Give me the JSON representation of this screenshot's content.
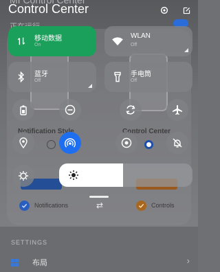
{
  "header": {
    "ghost_title": "MI Control Center",
    "title": "Control Center",
    "icons": [
      "settings-gear-icon",
      "edit-icon"
    ]
  },
  "background": {
    "subtitle": "正在运行",
    "notification_style_label": "Notification Style",
    "control_center_label": "Control Center",
    "tabs": {
      "notifications": "Notifications",
      "controls": "Controls"
    },
    "settings_heading": "SETTINGS",
    "layout_label": "布局"
  },
  "tiles": [
    {
      "name": "移动数据",
      "status": "On",
      "icon": "mobile-data-icon",
      "active": true
    },
    {
      "name": "WLAN",
      "status": "Off",
      "icon": "wifi-icon",
      "active": false
    },
    {
      "name": "蓝牙",
      "status": "Off",
      "icon": "bluetooth-icon",
      "active": false
    },
    {
      "name": "手电筒",
      "status": "Off",
      "icon": "flashlight-icon",
      "active": false
    }
  ],
  "toggles": [
    {
      "icon": "battery-saver-icon",
      "on": false
    },
    {
      "icon": "do-not-disturb-icon",
      "on": false
    },
    {
      "icon": "auto-rotate-icon",
      "on": false
    },
    {
      "icon": "airplane-mode-icon",
      "on": false
    },
    {
      "icon": "location-icon",
      "on": false
    },
    {
      "icon": "hotspot-icon",
      "on": true
    },
    {
      "icon": "screen-record-icon",
      "on": false
    },
    {
      "icon": "vibrate-off-icon",
      "on": false
    }
  ],
  "brightness": {
    "icon": "sun-icon",
    "auto_icon": "auto-brightness-gear-icon",
    "level": 0.48
  },
  "colors": {
    "accent": "#1e6ff0",
    "active_tile": "#1aa05a"
  }
}
